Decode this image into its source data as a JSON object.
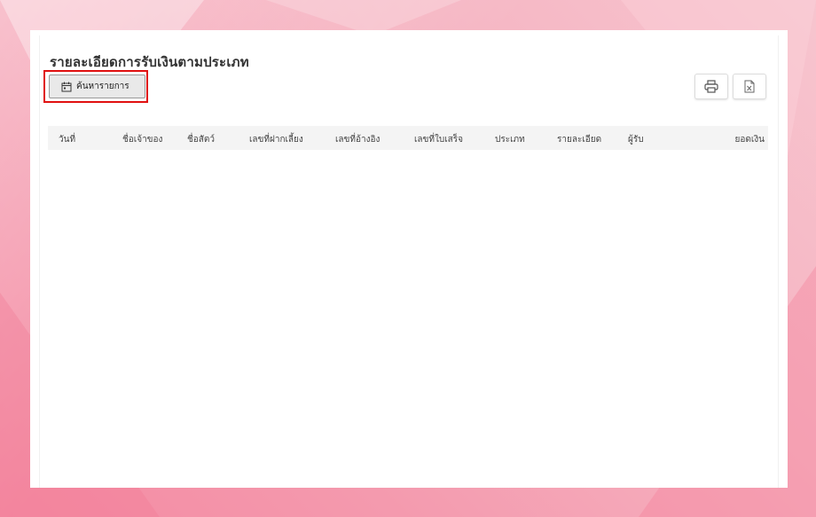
{
  "page": {
    "title": "รายละเอียดการรับเงินตามประเภท"
  },
  "toolbar": {
    "search_label": "ค้นหารายการ",
    "search_icon": "calendar-icon",
    "print_icon": "printer-icon",
    "excel_icon": "excel-file-icon"
  },
  "table": {
    "columns": [
      "วันที่",
      "ชื่อเจ้าของ",
      "ชื่อสัตว์",
      "เลขที่ฝากเลี้ยง",
      "เลขที่อ้างอิง",
      "เลขที่ใบเสร็จ",
      "ประเภท",
      "รายละเอียด",
      "ผู้รับ",
      "ยอดเงิน"
    ],
    "rows": []
  },
  "colors": {
    "highlight": "#e01010",
    "background_pink": "#f49aae"
  }
}
